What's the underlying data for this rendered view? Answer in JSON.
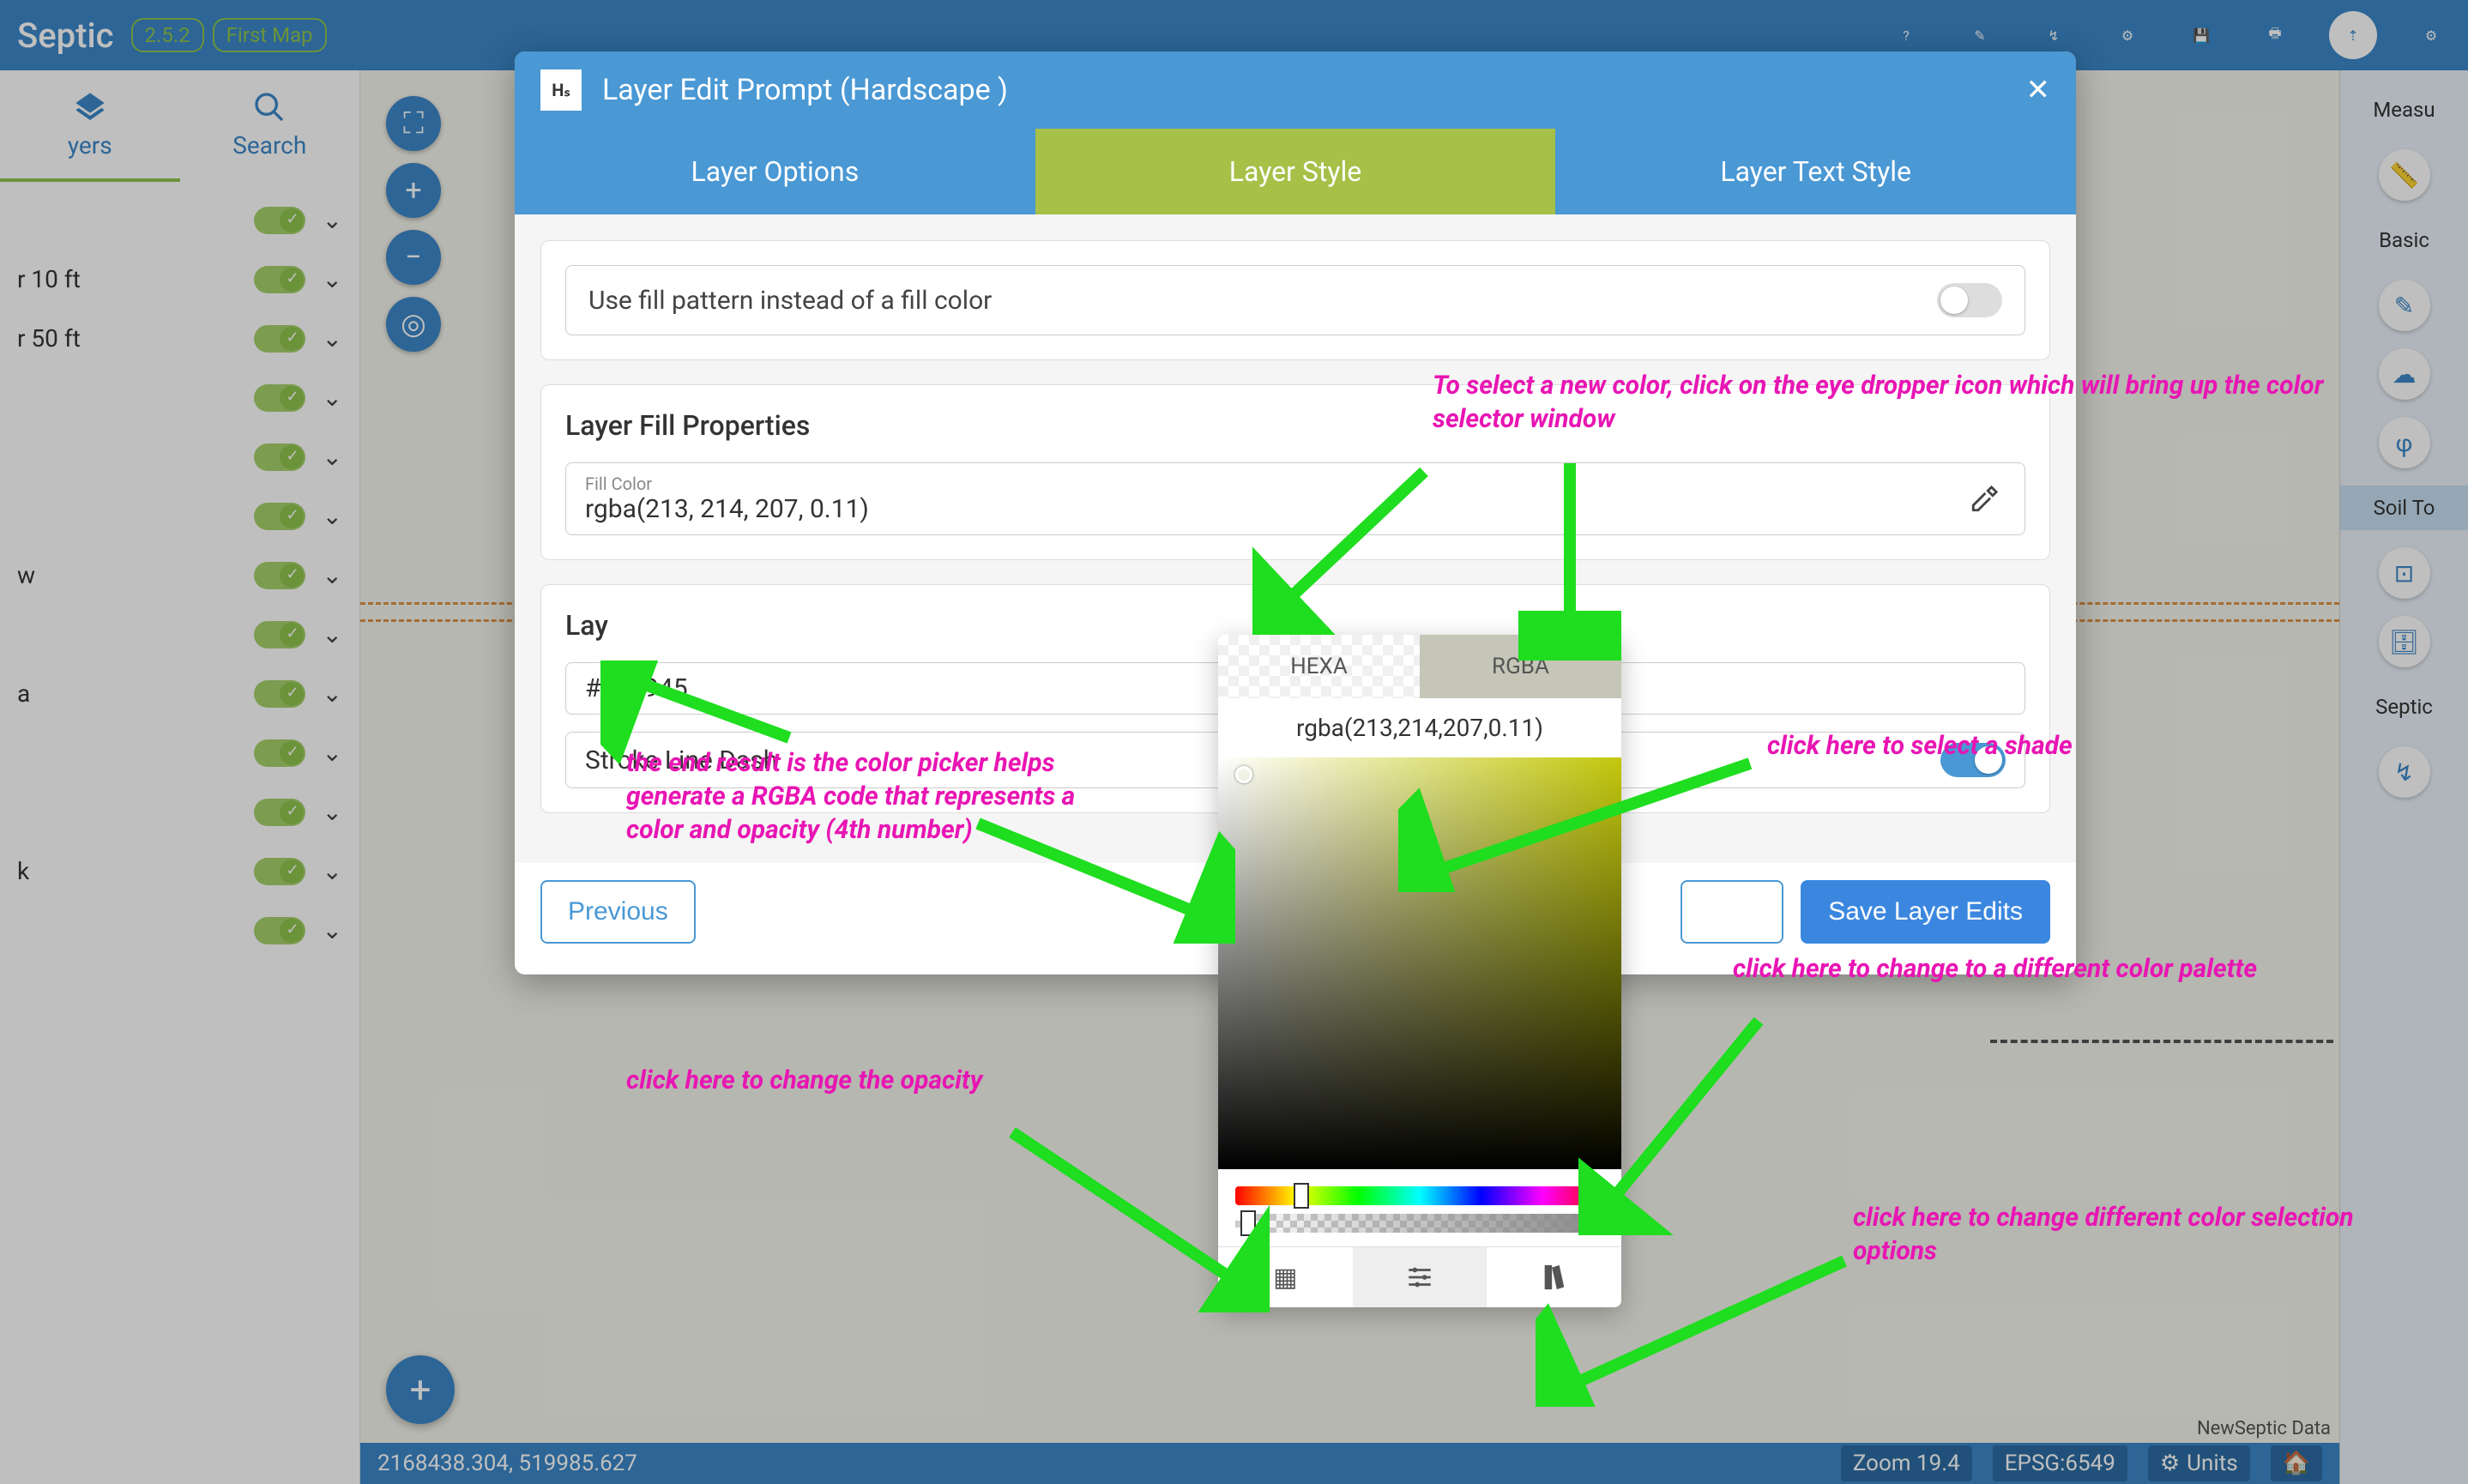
{
  "topbar": {
    "brand": "Septic",
    "version": "2.5.2",
    "map_name": "First Map"
  },
  "left_tabs": {
    "layers": "yers",
    "search": "Search"
  },
  "layers": [
    {
      "label": ""
    },
    {
      "label": "r 10 ft"
    },
    {
      "label": "r 50 ft"
    },
    {
      "label": ""
    },
    {
      "label": ""
    },
    {
      "label": ""
    },
    {
      "label": "w"
    },
    {
      "label": ""
    },
    {
      "label": "a"
    },
    {
      "label": ""
    },
    {
      "label": ""
    },
    {
      "label": "k"
    },
    {
      "label": ""
    }
  ],
  "right_sidebar": {
    "measure": "Measu",
    "basic": "Basic",
    "soil": "Soil To",
    "septic": "Septic"
  },
  "status": {
    "coords": "2168438.304, 519985.627",
    "zoom": "Zoom 19.4",
    "epsg": "EPSG:6549",
    "units": "Units"
  },
  "attribution": "NewSeptic Data",
  "modal": {
    "badge": "Hₛ",
    "title": "Layer Edit Prompt (Hardscape )",
    "tabs": {
      "options": "Layer Options",
      "style": "Layer Style",
      "text": "Layer Text Style"
    },
    "fill_pattern_label": "Use fill pattern instead of a fill color",
    "fill_section": "Layer Fill Properties",
    "fill_color_label": "Fill Color",
    "fill_color_value": "rgba(213, 214, 207, 0.11)",
    "stroke_section": "Lay",
    "stroke_color_value": "#494945",
    "stroke_dash_label": "Stroke Line Dash",
    "prev": "Previous",
    "save": "Save Layer Edits"
  },
  "picker": {
    "hexa": "HEXA",
    "rgba": "RGBA",
    "value": "rgba(213,214,207,0.11)"
  },
  "annotations": {
    "a1": "To select a new color, click on the eye dropper icon  which will bring up the color selector window",
    "a2": "the end result is the color picker helps generate a RGBA code that represents a color and opacity (4th number)",
    "a3": "click here to select a shade",
    "a4": "click here to change to a different color palette",
    "a5": "click here to change the opacity",
    "a6": "click here to change different color selection options"
  }
}
